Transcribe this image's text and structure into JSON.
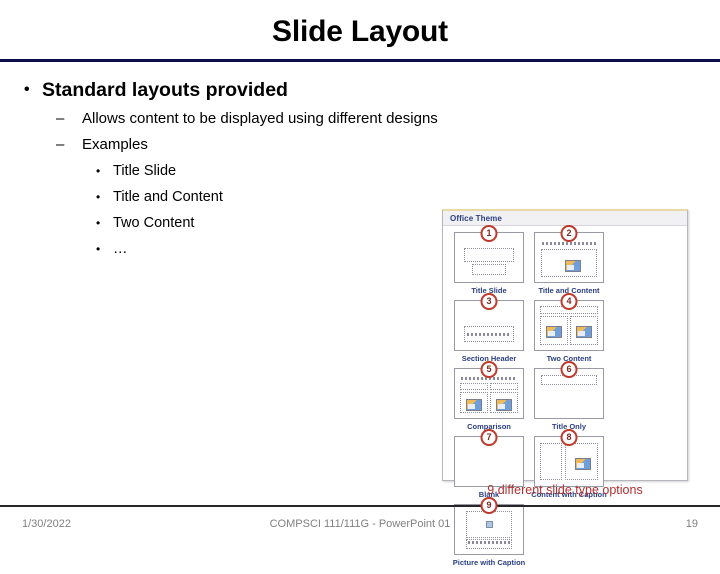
{
  "slide": {
    "title": "Slide Layout",
    "accent_rule_color": "#0d0d4d"
  },
  "body": {
    "level1": {
      "bullet": "•",
      "text": "Standard layouts provided"
    },
    "level2": [
      {
        "bullet": "–",
        "text": "Allows content to be displayed using different designs"
      },
      {
        "bullet": "–",
        "text": "Examples"
      }
    ],
    "level3": [
      {
        "bullet": "•",
        "text": "Title Slide"
      },
      {
        "bullet": "•",
        "text": "Title and Content"
      },
      {
        "bullet": "•",
        "text": "Two Content"
      },
      {
        "bullet": "•",
        "text": "…"
      }
    ]
  },
  "gallery": {
    "header_label": "Office Theme",
    "caption": "9 different slide type options",
    "caption_color": "#b03030",
    "badge_color": "#c0392b",
    "label_color": "#2b3f83",
    "items": [
      {
        "number": "1",
        "label": "Title Slide"
      },
      {
        "number": "2",
        "label": "Title and Content"
      },
      {
        "number": "3",
        "label": "Section Header"
      },
      {
        "number": "4",
        "label": "Two Content"
      },
      {
        "number": "5",
        "label": "Comparison"
      },
      {
        "number": "6",
        "label": "Title Only"
      },
      {
        "number": "7",
        "label": "Blank"
      },
      {
        "number": "8",
        "label": "Content with Caption"
      },
      {
        "number": "9",
        "label": "Picture with Caption"
      }
    ]
  },
  "footer": {
    "date": "1/30/2022",
    "center": "COMPSCI 111/111G - PowerPoint 01",
    "page": "19"
  }
}
